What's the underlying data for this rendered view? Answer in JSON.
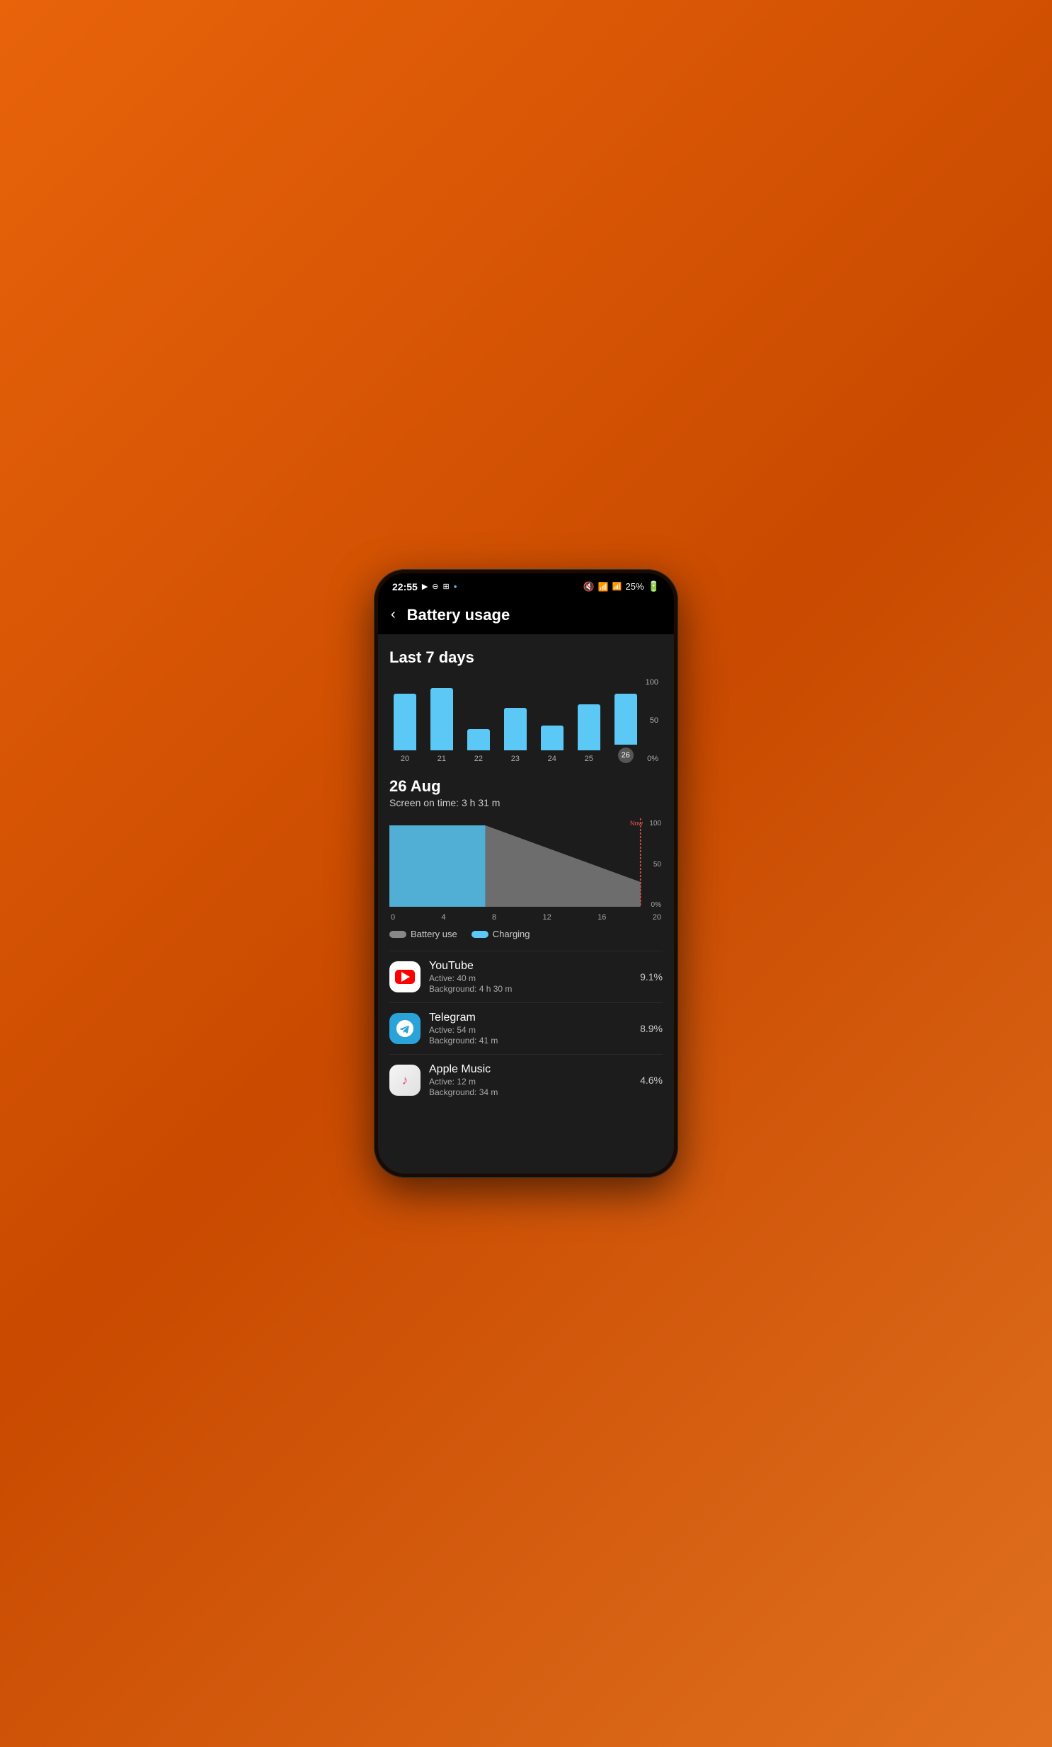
{
  "statusBar": {
    "time": "22:55",
    "icons": [
      "media-icon",
      "dnd-icon",
      "screen-record-icon",
      "dot-icon"
    ],
    "rightIcons": [
      "mute-icon",
      "wifi-icon",
      "signal-icon"
    ],
    "battery": "25%"
  },
  "header": {
    "backLabel": "‹",
    "title": "Battery usage"
  },
  "chart7days": {
    "sectionTitle": "Last 7 days",
    "yLabels": [
      "100",
      "50",
      "0%"
    ],
    "bars": [
      {
        "day": "20",
        "height": 80
      },
      {
        "day": "21",
        "height": 88
      },
      {
        "day": "22",
        "height": 30
      },
      {
        "day": "23",
        "height": 60
      },
      {
        "day": "24",
        "height": 35
      },
      {
        "day": "25",
        "height": 65
      },
      {
        "day": "26",
        "height": 72,
        "selected": true
      }
    ]
  },
  "daySection": {
    "date": "26 Aug",
    "screenOnTime": "Screen on time: 3 h 31 m",
    "timeLabels": [
      "0",
      "4",
      "8",
      "12",
      "16",
      "20"
    ],
    "yLabels": [
      "100",
      "50",
      "0%"
    ],
    "nowLabel": "Now"
  },
  "legend": {
    "batteryUseLabel": "Battery use",
    "chargingLabel": "Charging"
  },
  "apps": [
    {
      "name": "YouTube",
      "icon": "youtube",
      "activeTime": "Active: 40 m",
      "backgroundTime": "Background: 4 h 30 m",
      "percent": "9.1%"
    },
    {
      "name": "Telegram",
      "icon": "telegram",
      "activeTime": "Active: 54 m",
      "backgroundTime": "Background: 41 m",
      "percent": "8.9%"
    },
    {
      "name": "Apple Music",
      "icon": "apple-music",
      "activeTime": "Active: 12 m",
      "backgroundTime": "Background: 34 m",
      "percent": "4.6%"
    }
  ]
}
